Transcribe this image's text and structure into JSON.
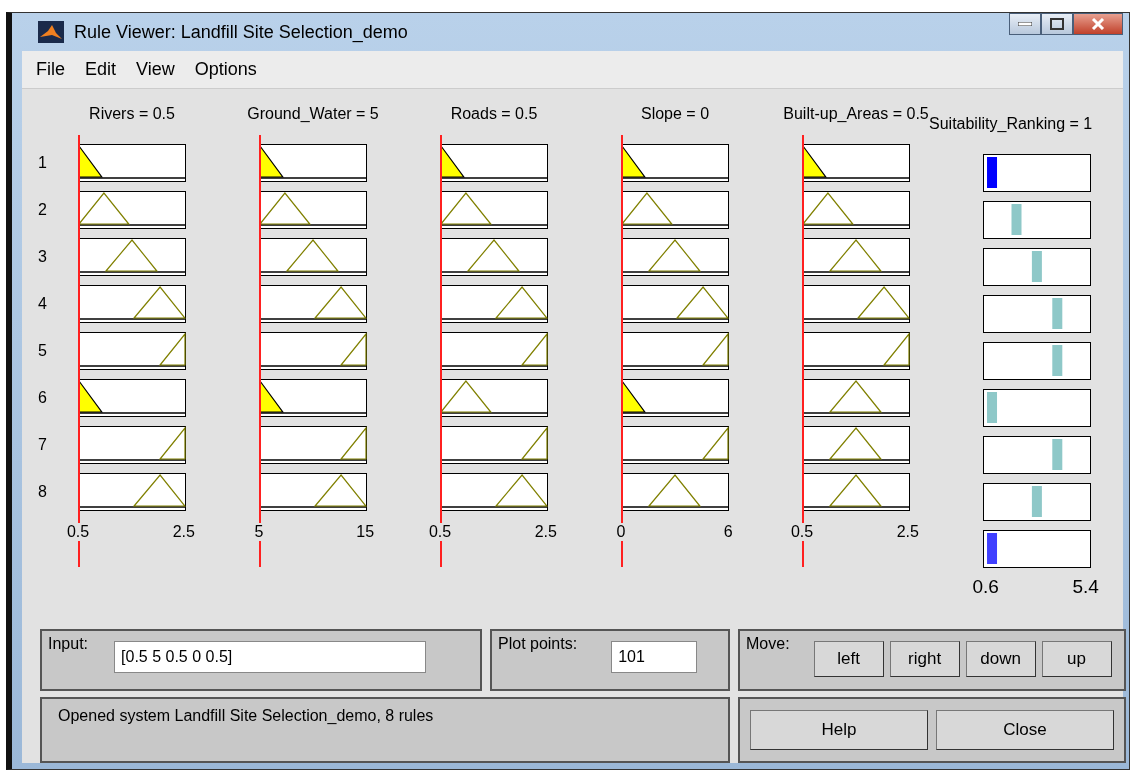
{
  "window": {
    "title": "Rule Viewer: Landfill Site Selection_demo"
  },
  "menu": [
    {
      "label": "File"
    },
    {
      "label": "Edit"
    },
    {
      "label": "View"
    },
    {
      "label": "Options"
    }
  ],
  "rule_numbers": [
    "1",
    "2",
    "3",
    "4",
    "5",
    "6",
    "7",
    "8"
  ],
  "inputs": [
    {
      "heading": "Rivers = 0.5",
      "axis_min": "0.5",
      "axis_max": "2.5",
      "mfs": [
        {
          "kind": "low",
          "fired": true
        },
        {
          "kind": "lowmid",
          "fired": false
        },
        {
          "kind": "mid",
          "fired": false
        },
        {
          "kind": "highmid",
          "fired": false
        },
        {
          "kind": "high",
          "fired": false
        },
        {
          "kind": "low",
          "fired": true
        },
        {
          "kind": "high",
          "fired": false
        },
        {
          "kind": "highmid",
          "fired": false
        }
      ]
    },
    {
      "heading": "Ground_Water = 5",
      "axis_min": "5",
      "axis_max": "15",
      "mfs": [
        {
          "kind": "low",
          "fired": true
        },
        {
          "kind": "lowmid",
          "fired": false
        },
        {
          "kind": "mid",
          "fired": false
        },
        {
          "kind": "highmid",
          "fired": false
        },
        {
          "kind": "high",
          "fired": false
        },
        {
          "kind": "low",
          "fired": true
        },
        {
          "kind": "high",
          "fired": false
        },
        {
          "kind": "highmid",
          "fired": false
        }
      ]
    },
    {
      "heading": "Roads = 0.5",
      "axis_min": "0.5",
      "axis_max": "2.5",
      "mfs": [
        {
          "kind": "low",
          "fired": true
        },
        {
          "kind": "lowmid",
          "fired": false
        },
        {
          "kind": "mid",
          "fired": false
        },
        {
          "kind": "highmid",
          "fired": false
        },
        {
          "kind": "high",
          "fired": false
        },
        {
          "kind": "lowmid",
          "fired": false
        },
        {
          "kind": "high",
          "fired": false
        },
        {
          "kind": "highmid",
          "fired": false
        }
      ]
    },
    {
      "heading": "Slope = 0",
      "axis_min": "0",
      "axis_max": "6",
      "mfs": [
        {
          "kind": "low",
          "fired": true
        },
        {
          "kind": "lowmid",
          "fired": false
        },
        {
          "kind": "mid",
          "fired": false
        },
        {
          "kind": "highmid",
          "fired": false
        },
        {
          "kind": "high",
          "fired": false
        },
        {
          "kind": "low",
          "fired": true
        },
        {
          "kind": "high",
          "fired": false
        },
        {
          "kind": "mid",
          "fired": false
        }
      ]
    },
    {
      "heading": "Built-up_Areas = 0.5",
      "axis_min": "0.5",
      "axis_max": "2.5",
      "mfs": [
        {
          "kind": "low",
          "fired": true
        },
        {
          "kind": "lowmid",
          "fired": false
        },
        {
          "kind": "mid",
          "fired": false
        },
        {
          "kind": "highmid",
          "fired": false
        },
        {
          "kind": "high",
          "fired": false
        },
        {
          "kind": "mid",
          "fired": false
        },
        {
          "kind": "mid",
          "fired": false
        },
        {
          "kind": "mid",
          "fired": false
        }
      ]
    }
  ],
  "output": {
    "heading": "Suitability_Ranking = 1",
    "axis_min": "0.6",
    "axis_max": "5.4",
    "mfs": [
      {
        "kind": "low",
        "fired": true
      },
      {
        "kind": "lowmid",
        "fired": false
      },
      {
        "kind": "mid",
        "fired": false
      },
      {
        "kind": "high",
        "fired": false
      },
      {
        "kind": "high",
        "fired": false
      },
      {
        "kind": "low",
        "fired": false
      },
      {
        "kind": "high",
        "fired": false
      },
      {
        "kind": "mid",
        "fired": false
      }
    ],
    "aggregate": {
      "kind": "low"
    }
  },
  "input_field": {
    "label": "Input:",
    "value": "[0.5 5 0.5 0 0.5]"
  },
  "plot_points": {
    "label": "Plot points:",
    "value": "101"
  },
  "move": {
    "label": "Move:",
    "buttons": [
      "left",
      "right",
      "down",
      "up"
    ]
  },
  "status": "Opened system Landfill Site Selection_demo, 8 rules",
  "buttons": [
    "Help",
    "Close"
  ]
}
